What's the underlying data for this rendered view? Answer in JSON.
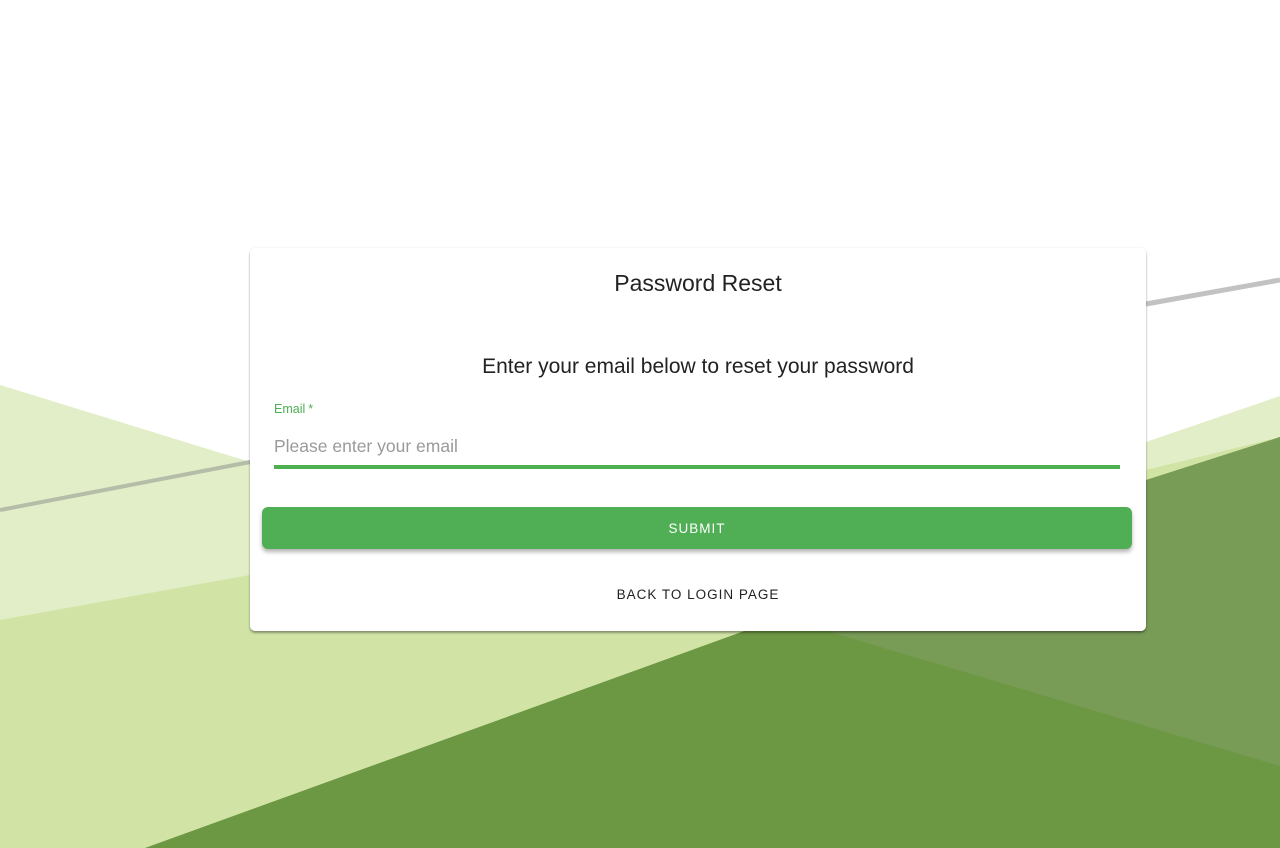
{
  "colors": {
    "accent": "#4caf50",
    "bg_light_green": "#e0edc4",
    "bg_mid_green": "#d0e3a5",
    "bg_dark_green": "#6b9643",
    "bg_olive": "#789a55"
  },
  "reset_card": {
    "title": "Password Reset",
    "instructions": "Enter your email below to reset your password",
    "email_field": {
      "label": "Email",
      "required_marker": "*",
      "placeholder": "Please enter your email",
      "value": ""
    },
    "submit_label": "SUBMIT",
    "back_label": "BACK TO LOGIN PAGE"
  }
}
